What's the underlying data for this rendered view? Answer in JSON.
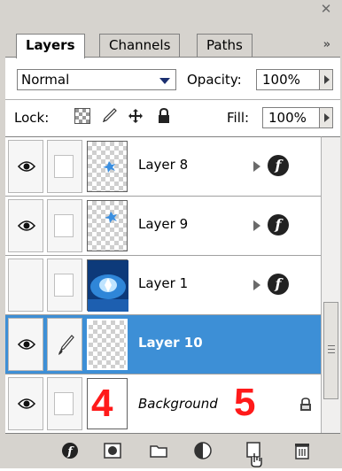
{
  "panel": {
    "tabs": [
      {
        "label": "Layers",
        "active": true
      },
      {
        "label": "Channels",
        "active": false
      },
      {
        "label": "Paths",
        "active": false
      }
    ],
    "close_icon": "close-icon",
    "menu_icon": "panel-menu-icon",
    "menu_glyph": "»"
  },
  "options": {
    "blend_mode": "Normal",
    "opacity_label": "Opacity:",
    "opacity_value": "100%",
    "lock_label": "Lock:",
    "fill_label": "Fill:",
    "fill_value": "100%"
  },
  "layers": [
    {
      "name": "Layer 8",
      "visible": true,
      "has_fx": true,
      "selected": false
    },
    {
      "name": "Layer 9",
      "visible": true,
      "has_fx": true,
      "selected": false
    },
    {
      "name": "Layer 1",
      "visible": false,
      "has_fx": true,
      "selected": false
    },
    {
      "name": "Layer 10",
      "visible": true,
      "has_fx": false,
      "selected": true
    },
    {
      "name": "Background",
      "visible": true,
      "has_fx": false,
      "selected": false,
      "locked": true
    }
  ],
  "annotations": {
    "left_number": "4",
    "right_number": "5"
  },
  "colors": {
    "selection": "#3d8fd6",
    "annotation_red": "#ff1a1a",
    "panel_bg": "#d6d3ce"
  },
  "toolbar": {
    "icons": [
      "link-layers-icon",
      "layer-style-icon",
      "layer-mask-icon",
      "new-group-icon",
      "adjustment-layer-icon",
      "new-layer-icon",
      "trash-icon"
    ]
  }
}
